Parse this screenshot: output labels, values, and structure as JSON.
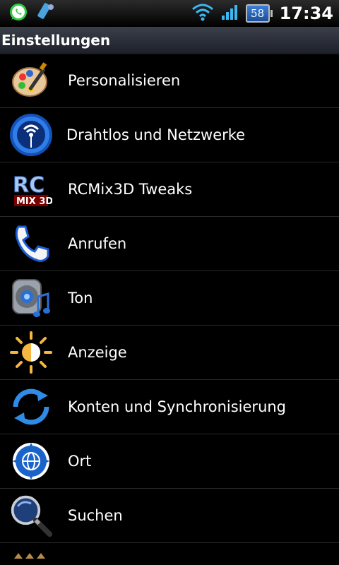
{
  "status_bar": {
    "time": "17:34",
    "battery_level": "58",
    "icons": [
      "whatsapp-icon",
      "usb-debug-icon",
      "wifi-icon",
      "signal-icon",
      "battery-icon"
    ]
  },
  "header": {
    "title": "Einstellungen"
  },
  "settings": {
    "items": [
      {
        "label": "Personalisieren",
        "icon": "palette-icon"
      },
      {
        "label": "Drahtlos und Netzwerke",
        "icon": "wireless-icon"
      },
      {
        "label": "RCMix3D Tweaks",
        "icon": "rcmix-logo-icon"
      },
      {
        "label": "Anrufen",
        "icon": "phone-icon"
      },
      {
        "label": "Ton",
        "icon": "speaker-icon"
      },
      {
        "label": "Anzeige",
        "icon": "brightness-icon"
      },
      {
        "label": "Konten und Synchronisierung",
        "icon": "sync-icon"
      },
      {
        "label": "Ort",
        "icon": "location-icon"
      },
      {
        "label": "Suchen",
        "icon": "search-icon"
      }
    ]
  }
}
